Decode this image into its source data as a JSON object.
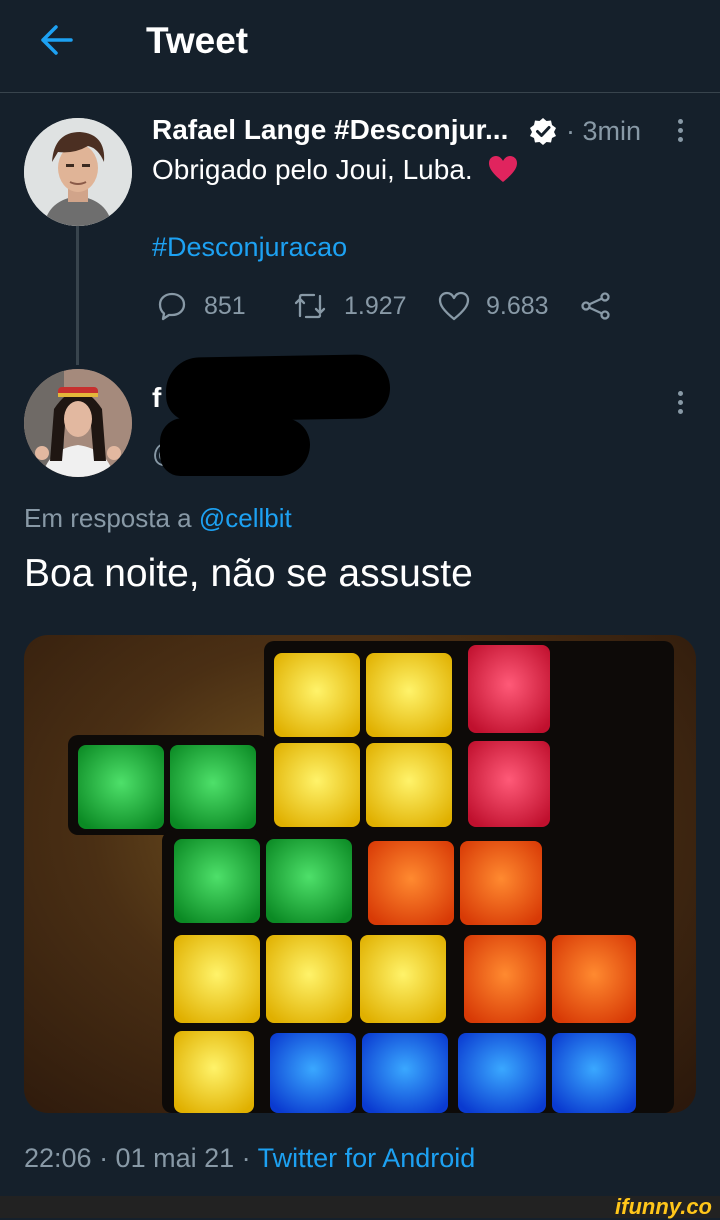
{
  "header": {
    "title": "Tweet",
    "back_icon": "arrow-left-icon",
    "accent": "#1da1f2"
  },
  "tweet": {
    "author_name": "Rafael Lange #Desconjur...",
    "verified_icon": "verified-badge-icon",
    "time": "· 3min",
    "text": "Obrigado pelo Joui, Luba.",
    "heart_color": "#e0245e",
    "hashtag": "#Desconjuracao",
    "actions": {
      "replies": "851",
      "retweets": "1.927",
      "likes": "9.683"
    }
  },
  "reply": {
    "author_name_visible": "f",
    "handle_visible": "@",
    "replying_prefix": "Em resposta a",
    "replying_to": "@cellbit",
    "text": "Boa noite, não se assuste",
    "image": "tetris-lamp-photo",
    "timestamp": "22:06 · 01 mai 21 ·",
    "source": "Twitter for Android"
  },
  "watermark": "ifunny.co"
}
